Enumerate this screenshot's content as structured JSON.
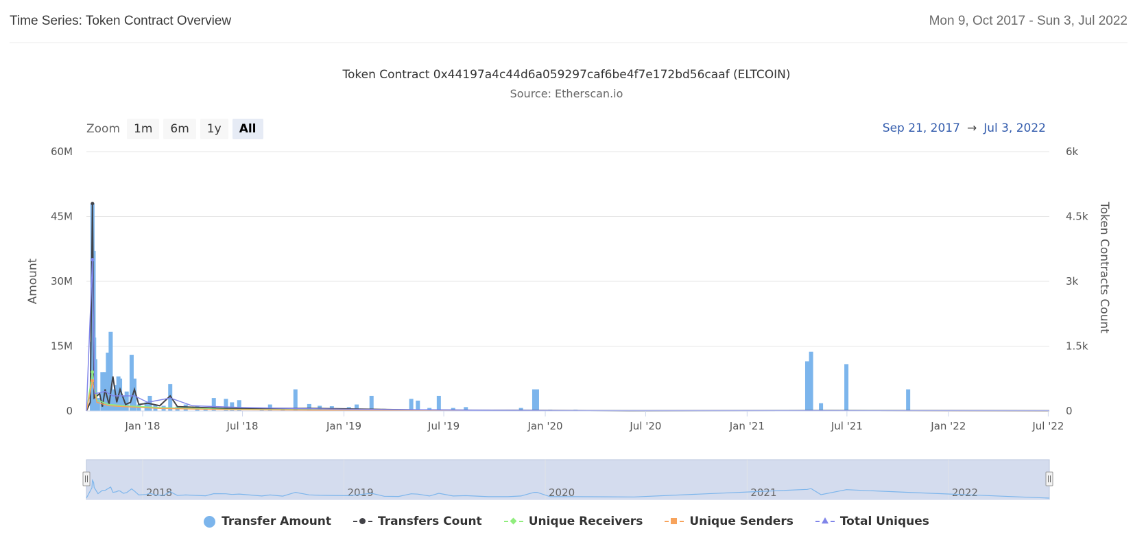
{
  "header": {
    "title": "Time Series: Token Contract Overview",
    "range": "Mon 9, Oct 2017 - Sun 3, Jul 2022"
  },
  "zoom": {
    "label": "Zoom",
    "buttons": [
      "1m",
      "6m",
      "1y",
      "All"
    ],
    "active": "All"
  },
  "date_range": {
    "from": "Sep 21, 2017",
    "arrow": "→",
    "to": "Jul 3, 2022"
  },
  "colors": {
    "transfer_amount": "#7cb5ec",
    "transfers_count": "#434348",
    "unique_receivers": "#90ed7d",
    "unique_senders": "#f7a35c",
    "total_uniques": "#8085e9",
    "grid": "#e6e6e6",
    "navigator_mask": "#ccd6eb"
  },
  "navigator": {
    "year_labels": [
      "2018",
      "2019",
      "2020",
      "2021",
      "2022"
    ]
  },
  "chart_data": {
    "type": "bar",
    "title": "Token Contract 0x44197a4c44d6a059297caf6be4f7e172bd56caaf (ELTCOIN)",
    "subtitle": "Source: Etherscan.io",
    "x_range": [
      "2017-09-21",
      "2022-07-03"
    ],
    "x_tick_labels": [
      "Jan '18",
      "Jul '18",
      "Jan '19",
      "Jul '19",
      "Jan '20",
      "Jul '20",
      "Jan '21",
      "Jul '21",
      "Jan '22",
      "Jul '22"
    ],
    "y_left": {
      "label": "Amount",
      "ticks": [
        "0",
        "15M",
        "30M",
        "45M",
        "60M"
      ],
      "range": [
        0,
        60000000
      ]
    },
    "y_right": {
      "label": "Token Contracts Count",
      "ticks": [
        "0",
        "1.5k",
        "3k",
        "4.5k",
        "6k"
      ],
      "range": [
        0,
        6000
      ]
    },
    "grid": true,
    "legend_position": "bottom",
    "series": [
      {
        "name": "Transfer Amount",
        "axis": "left",
        "type": "column",
        "points": [
          [
            "2017-10-01",
            16000000
          ],
          [
            "2017-10-02",
            48000000
          ],
          [
            "2017-10-04",
            37000000
          ],
          [
            "2017-10-05",
            17000000
          ],
          [
            "2017-10-07",
            12000000
          ],
          [
            "2017-10-12",
            3000000
          ],
          [
            "2017-10-20",
            9000000
          ],
          [
            "2017-10-25",
            9000000
          ],
          [
            "2017-10-30",
            13500000
          ],
          [
            "2017-11-04",
            18300000
          ],
          [
            "2017-11-08",
            5000000
          ],
          [
            "2017-11-14",
            6000000
          ],
          [
            "2017-11-18",
            8000000
          ],
          [
            "2017-11-21",
            7500000
          ],
          [
            "2017-11-27",
            3500000
          ],
          [
            "2017-12-03",
            4500000
          ],
          [
            "2017-12-12",
            13000000
          ],
          [
            "2017-12-17",
            7500000
          ],
          [
            "2017-12-25",
            1500000
          ],
          [
            "2018-01-08",
            2000000
          ],
          [
            "2018-01-14",
            3500000
          ],
          [
            "2018-01-24",
            1500000
          ],
          [
            "2018-02-08",
            1200000
          ],
          [
            "2018-02-20",
            6200000
          ],
          [
            "2018-03-05",
            1000000
          ],
          [
            "2018-03-20",
            1500000
          ],
          [
            "2018-04-10",
            1100000
          ],
          [
            "2018-04-25",
            800000
          ],
          [
            "2018-05-10",
            3000000
          ],
          [
            "2018-06-01",
            2800000
          ],
          [
            "2018-06-12",
            2000000
          ],
          [
            "2018-06-25",
            2500000
          ],
          [
            "2018-08-05",
            700000
          ],
          [
            "2018-08-20",
            1500000
          ],
          [
            "2018-09-12",
            600000
          ],
          [
            "2018-10-05",
            5000000
          ],
          [
            "2018-10-30",
            1600000
          ],
          [
            "2018-11-18",
            1200000
          ],
          [
            "2018-12-10",
            1100000
          ],
          [
            "2019-01-10",
            900000
          ],
          [
            "2019-01-24",
            1500000
          ],
          [
            "2019-02-20",
            3500000
          ],
          [
            "2019-03-15",
            500000
          ],
          [
            "2019-04-10",
            400000
          ],
          [
            "2019-05-03",
            2800000
          ],
          [
            "2019-05-15",
            2400000
          ],
          [
            "2019-06-05",
            700000
          ],
          [
            "2019-06-22",
            3500000
          ],
          [
            "2019-07-18",
            700000
          ],
          [
            "2019-08-10",
            900000
          ],
          [
            "2019-09-20",
            300000
          ],
          [
            "2019-10-25",
            300000
          ],
          [
            "2019-11-18",
            700000
          ],
          [
            "2020-01-10",
            300000
          ],
          [
            "2019-12-12",
            5000000
          ],
          [
            "2019-12-17",
            5000000
          ],
          [
            "2020-02-25",
            300000
          ],
          [
            "2020-06-10",
            200000
          ],
          [
            "2021-04-20",
            11500000
          ],
          [
            "2021-04-27",
            13700000
          ],
          [
            "2021-05-15",
            1800000
          ],
          [
            "2021-06-30",
            10800000
          ],
          [
            "2021-10-20",
            5000000
          ]
        ]
      },
      {
        "name": "Transfers Count",
        "axis": "right",
        "type": "line",
        "points": [
          [
            "2017-09-21",
            0
          ],
          [
            "2017-09-28",
            200
          ],
          [
            "2017-10-02",
            4800
          ],
          [
            "2017-10-05",
            300
          ],
          [
            "2017-10-15",
            400
          ],
          [
            "2017-10-20",
            100
          ],
          [
            "2017-10-25",
            500
          ],
          [
            "2017-11-01",
            150
          ],
          [
            "2017-11-08",
            800
          ],
          [
            "2017-11-15",
            200
          ],
          [
            "2017-11-21",
            500
          ],
          [
            "2017-12-01",
            150
          ],
          [
            "2017-12-10",
            200
          ],
          [
            "2017-12-17",
            500
          ],
          [
            "2017-12-25",
            150
          ],
          [
            "2018-01-10",
            180
          ],
          [
            "2018-02-01",
            120
          ],
          [
            "2018-02-20",
            350
          ],
          [
            "2018-03-05",
            100
          ],
          [
            "2018-06-01",
            60
          ],
          [
            "2018-11-01",
            60
          ],
          [
            "2019-06-01",
            20
          ],
          [
            "2020-06-01",
            5
          ],
          [
            "2021-06-01",
            10
          ],
          [
            "2022-07-03",
            5
          ]
        ]
      },
      {
        "name": "Unique Receivers",
        "axis": "right",
        "type": "line",
        "points": [
          [
            "2017-09-21",
            0
          ],
          [
            "2017-10-02",
            900
          ],
          [
            "2017-10-10",
            250
          ],
          [
            "2017-11-01",
            150
          ],
          [
            "2017-12-01",
            120
          ],
          [
            "2018-02-01",
            80
          ],
          [
            "2018-06-01",
            40
          ],
          [
            "2019-06-01",
            10
          ],
          [
            "2022-07-03",
            3
          ]
        ]
      },
      {
        "name": "Unique Senders",
        "axis": "right",
        "type": "line",
        "points": [
          [
            "2017-09-21",
            0
          ],
          [
            "2017-10-02",
            700
          ],
          [
            "2017-10-10",
            200
          ],
          [
            "2017-11-01",
            120
          ],
          [
            "2017-12-01",
            100
          ],
          [
            "2018-02-01",
            60
          ],
          [
            "2018-06-01",
            30
          ],
          [
            "2019-06-01",
            8
          ],
          [
            "2022-07-03",
            2
          ]
        ]
      },
      {
        "name": "Total Uniques",
        "axis": "right",
        "type": "line",
        "points": [
          [
            "2017-09-21",
            0
          ],
          [
            "2017-10-02",
            3500
          ],
          [
            "2017-10-06",
            400
          ],
          [
            "2017-10-25",
            450
          ],
          [
            "2017-11-08",
            350
          ],
          [
            "2017-12-17",
            350
          ],
          [
            "2018-01-10",
            200
          ],
          [
            "2018-02-20",
            300
          ],
          [
            "2018-04-01",
            120
          ],
          [
            "2018-07-01",
            80
          ],
          [
            "2019-01-01",
            40
          ],
          [
            "2020-01-01",
            10
          ],
          [
            "2022-07-03",
            5
          ]
        ]
      }
    ]
  }
}
